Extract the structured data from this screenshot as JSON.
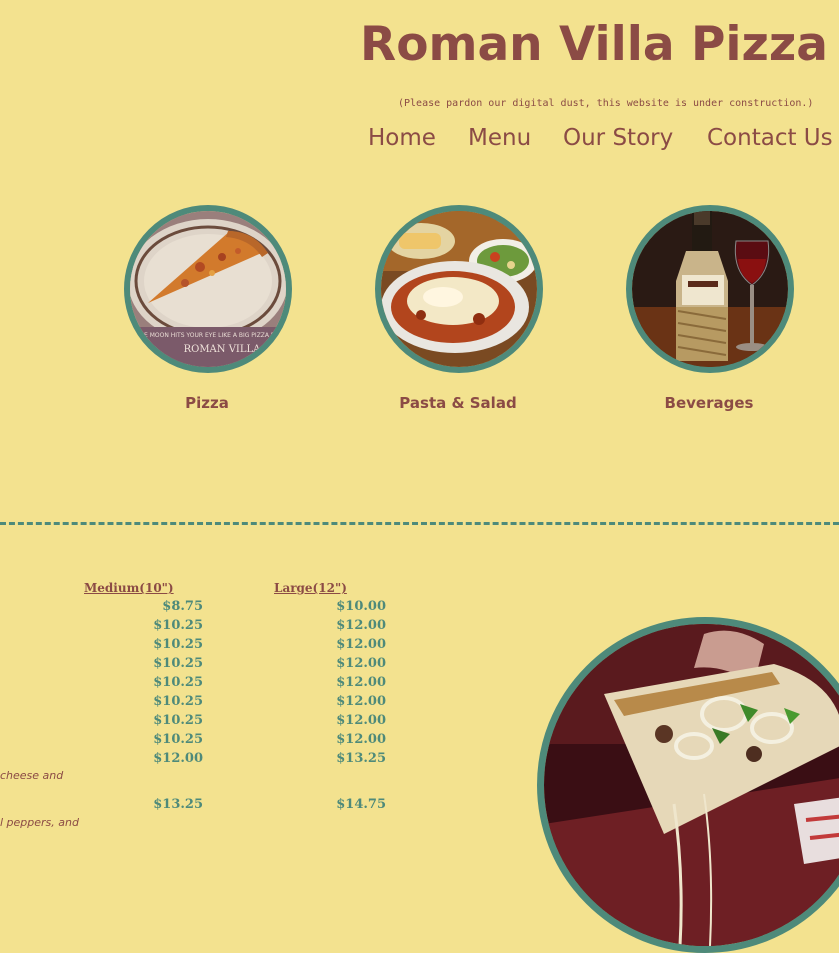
{
  "header": {
    "title": "Roman Villa Pizza",
    "notice": "(Please pardon our digital dust, this website is under construction.)"
  },
  "nav": {
    "items": [
      {
        "label": "Home"
      },
      {
        "label": "Menu"
      },
      {
        "label": "Our Story"
      },
      {
        "label": "Contact Us"
      }
    ]
  },
  "categories": [
    {
      "label": "Pizza",
      "image_caption": "ROMAN VILLA",
      "image_small_text": "THE MOON HITS YOUR EYE LIKE A BIG PIZZA PIE"
    },
    {
      "label": "Pasta & Salad"
    },
    {
      "label": "Beverages"
    }
  ],
  "menu": {
    "columns": [
      "Medium(10\")",
      "Large(12\")"
    ],
    "rows": [
      {
        "medium": "$8.75",
        "large": "$10.00"
      },
      {
        "medium": "$10.25",
        "large": "$12.00"
      },
      {
        "medium": "$10.25",
        "large": "$12.00"
      },
      {
        "medium": "$10.25",
        "large": "$12.00"
      },
      {
        "medium": "$10.25",
        "large": "$12.00"
      },
      {
        "medium": "$10.25",
        "large": "$12.00"
      },
      {
        "medium": "$10.25",
        "large": "$12.00"
      },
      {
        "medium": "$10.25",
        "large": "$12.00"
      },
      {
        "medium": "$12.00",
        "large": "$13.25"
      },
      {
        "medium": "$13.25",
        "large": "$14.75"
      }
    ],
    "descriptions": [
      " cheese and",
      "l peppers, and"
    ]
  },
  "colors": {
    "background": "#f3e28f",
    "brand": "#8b4b45",
    "accent": "#4e8a7a"
  }
}
